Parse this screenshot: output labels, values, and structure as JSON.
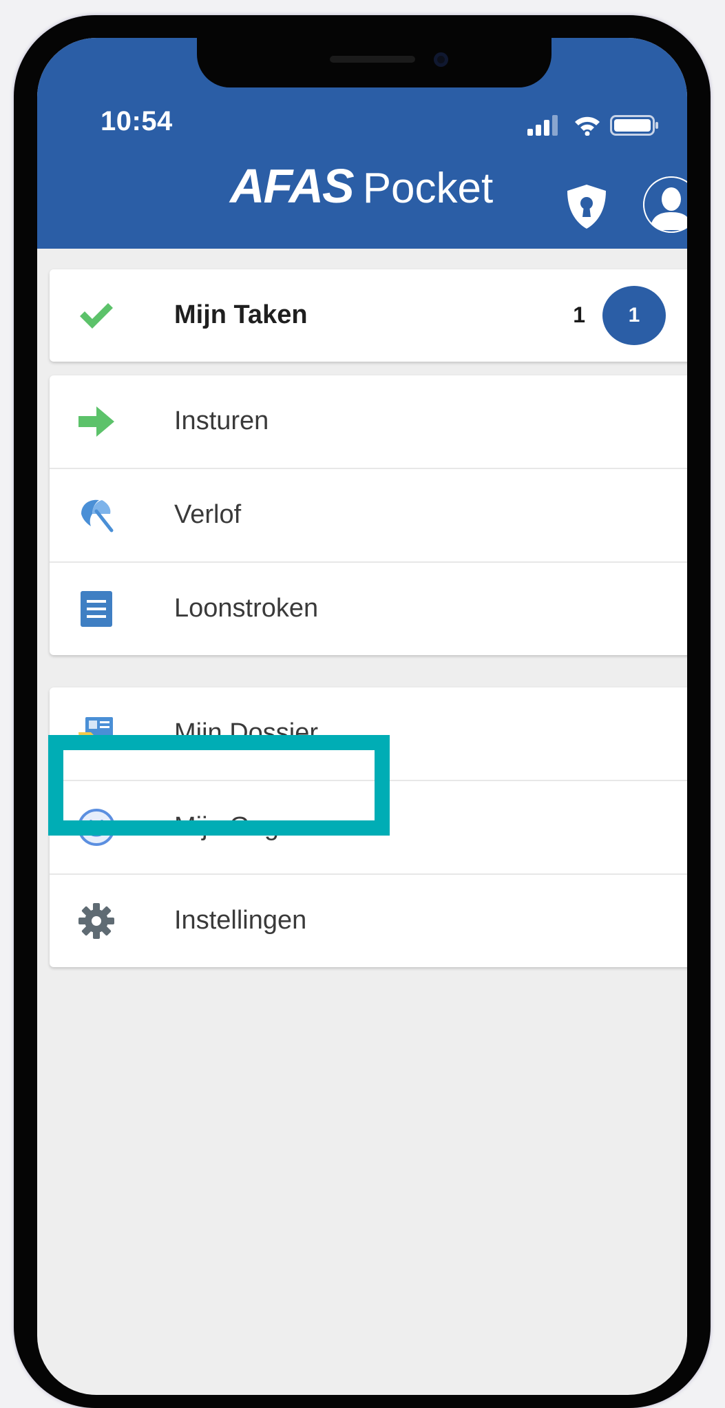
{
  "status_bar": {
    "time": "10:54"
  },
  "header": {
    "brand_bold": "AFAS",
    "brand_light": "Pocket",
    "accent_color": "#2b5ea6"
  },
  "tasks": {
    "label": "Mijn Taken",
    "count": "1",
    "badge": "1"
  },
  "menu_group_1": [
    {
      "label": "Insturen",
      "icon": "arrow-right-icon"
    },
    {
      "label": "Verlof",
      "icon": "beach-umbrella-icon"
    },
    {
      "label": "Loonstroken",
      "icon": "document-icon"
    }
  ],
  "menu_group_2": [
    {
      "label": "Mijn Dossier",
      "icon": "folder-id-card-icon"
    },
    {
      "label": "Mijn Gegevens",
      "icon": "smiley-icon",
      "highlighted": true
    },
    {
      "label": "Instellingen",
      "icon": "gear-icon"
    }
  ],
  "highlight_color": "#00adb5"
}
